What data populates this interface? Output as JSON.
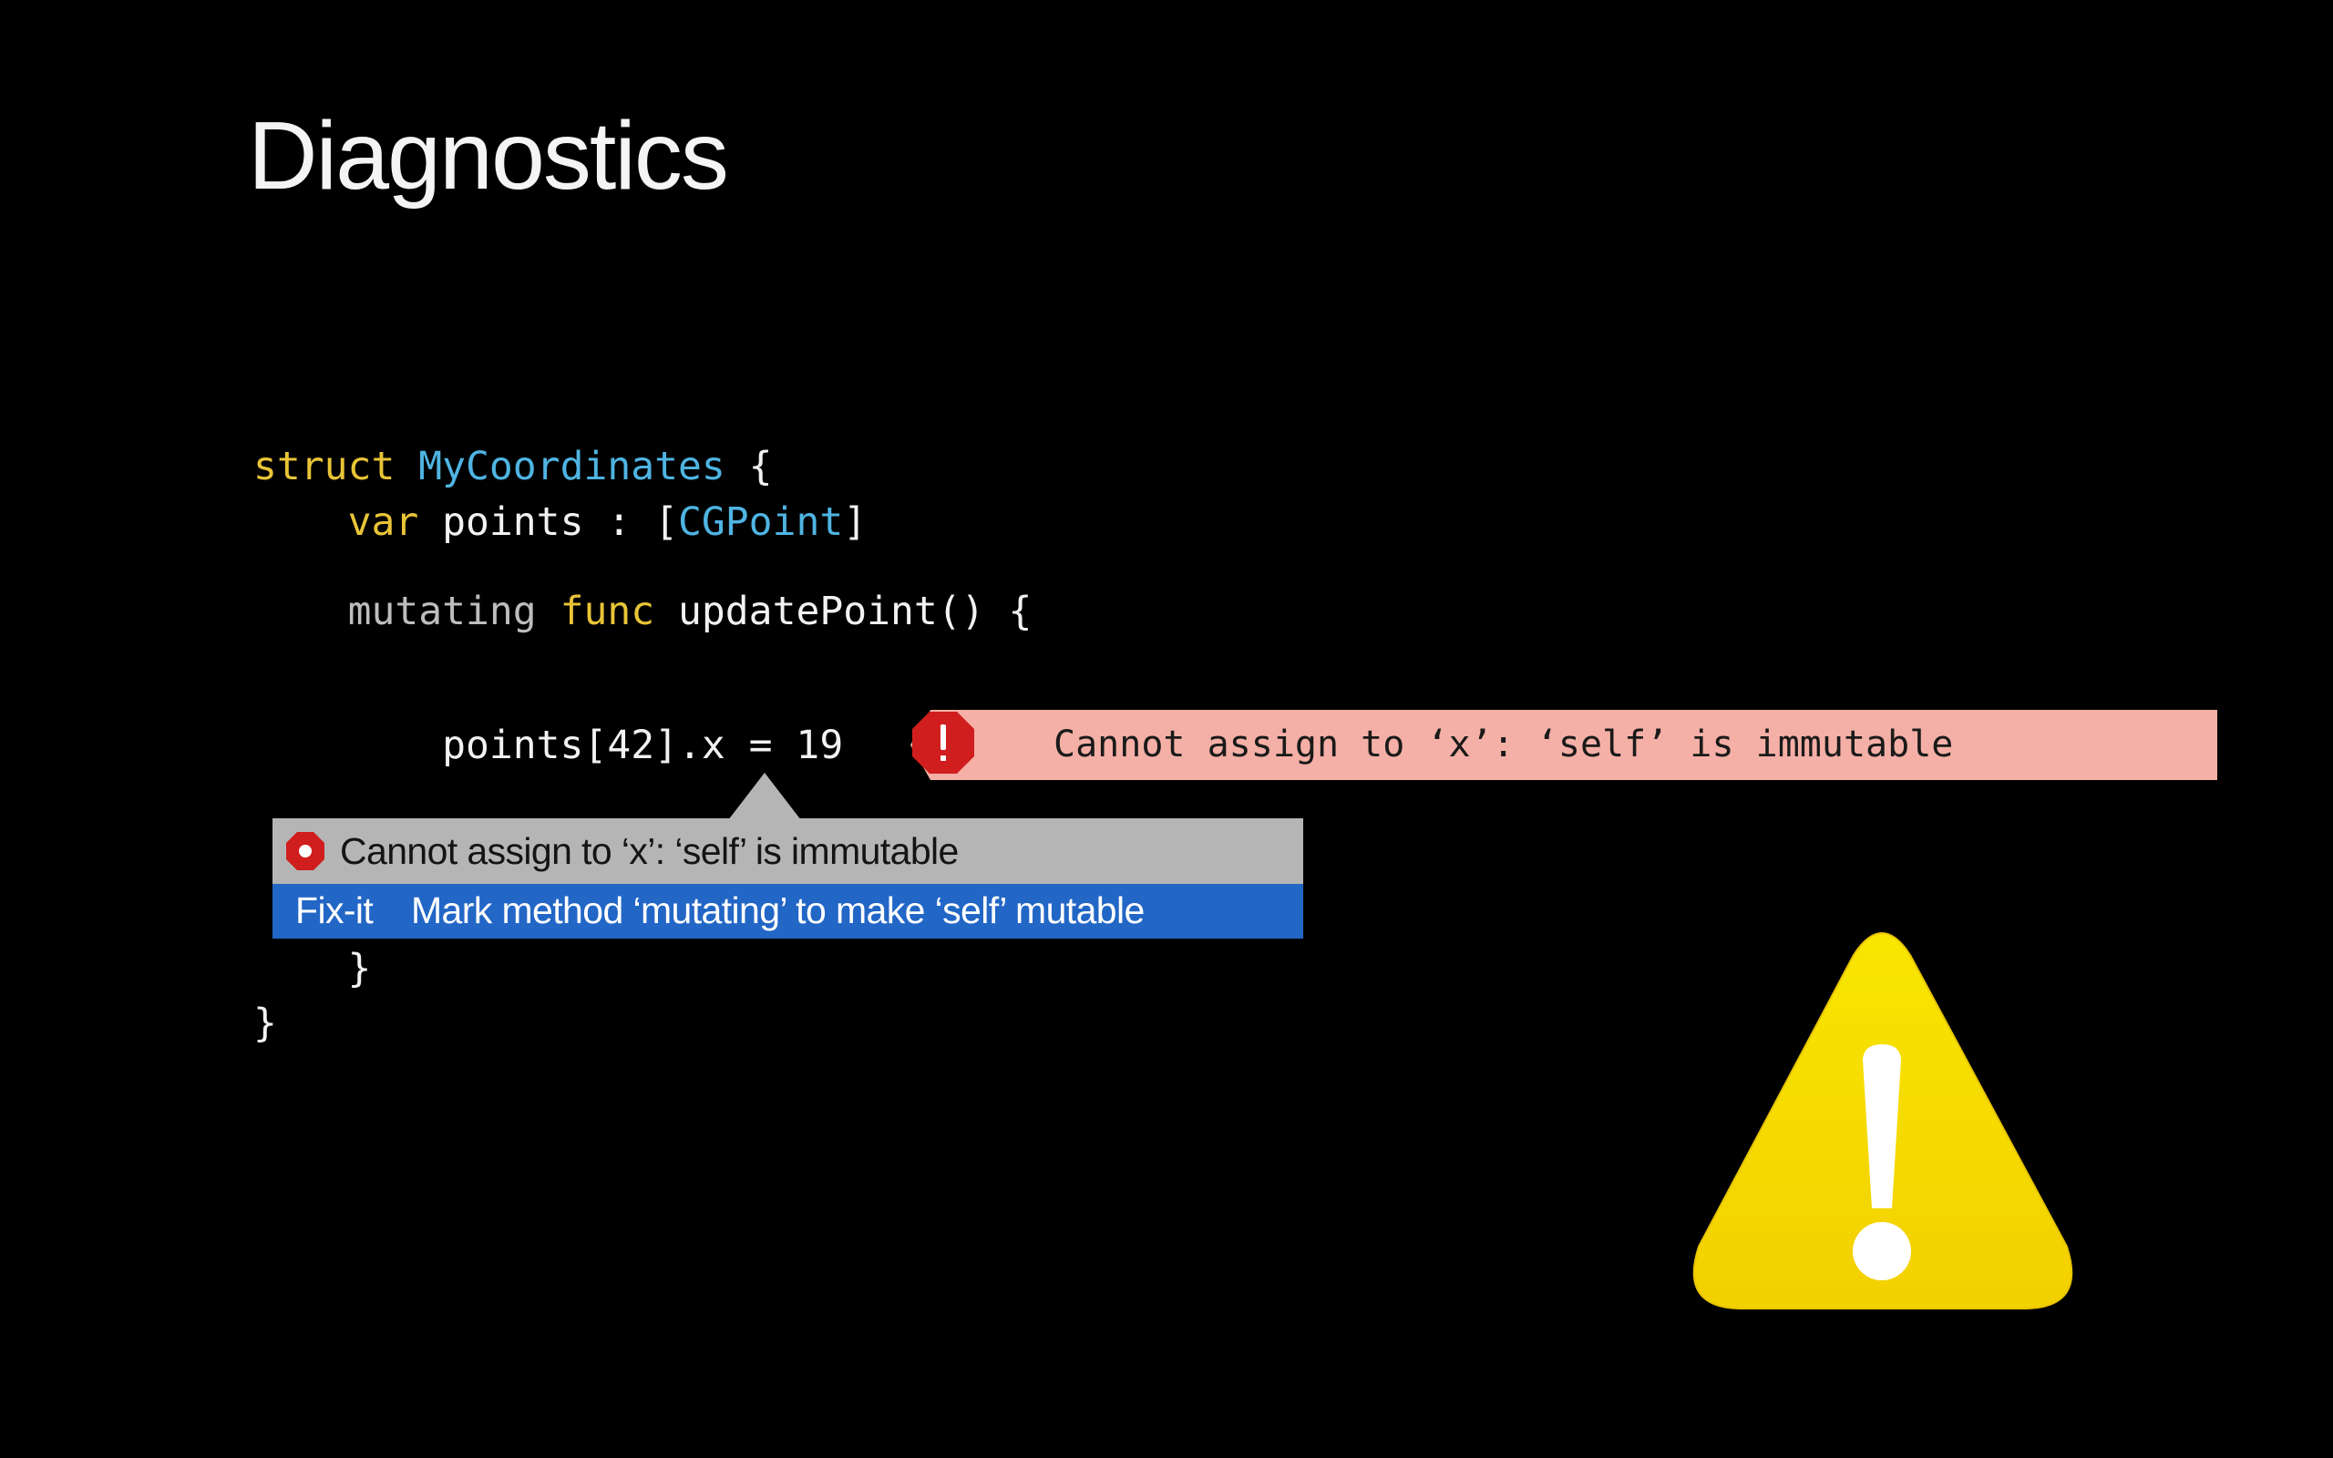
{
  "slide": {
    "title": "Diagnostics"
  },
  "code": {
    "line1": {
      "kw": "struct",
      "sp": " ",
      "type": "MyCoordinates",
      "rest": " {"
    },
    "line2": {
      "indent": "    ",
      "kw": "var",
      "rest": " points : [",
      "type": "CGPoint",
      "end": "]"
    },
    "line3": {
      "indent": "    ",
      "mod": "mutating",
      "sp": " ",
      "kw": "func",
      "rest": " updatePoint() {"
    },
    "line4": {
      "text": "        points[42].x = 19"
    },
    "line5": {
      "text": "    }"
    },
    "line6": {
      "text": "}"
    }
  },
  "inline_error": {
    "icon": "error-octagon-icon",
    "message": "Cannot assign to ‘x’: ‘self’ is immutable",
    "color": "#f4b0a6"
  },
  "popup": {
    "message": "Cannot assign to ‘x’: ‘self’ is immutable",
    "fixit_label": "Fix-it",
    "fixit_text": "Mark method ‘mutating’ to make ‘self’ mutable",
    "icon": "error-octagon-icon",
    "message_bg": "#b5b5b5",
    "fixit_bg": "#2266c6"
  },
  "decoration": {
    "icon": "warning-triangle-icon",
    "color": "#f7dd00"
  }
}
